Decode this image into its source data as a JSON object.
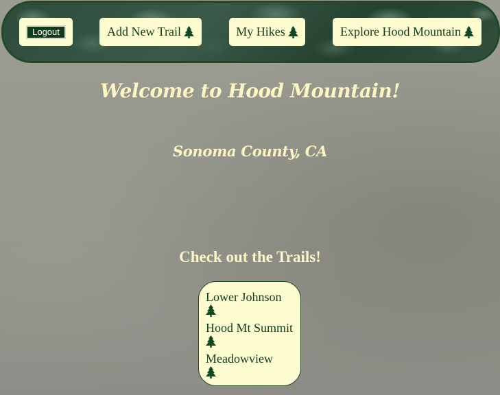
{
  "navbar": {
    "logout_label": "Logout",
    "links": [
      {
        "label": "Add New Trail",
        "icon": "tree-icon"
      },
      {
        "label": "My Hikes",
        "icon": "tree-icon"
      },
      {
        "label": "Explore Hood Mountain",
        "icon": "tree-icon"
      }
    ]
  },
  "hero": {
    "welcome": "Welcome to Hood Mountain!",
    "location": "Sonoma County, CA"
  },
  "trails": {
    "heading": "Check out the Trails!",
    "items": [
      {
        "name": "Lower Johnson",
        "icon": "tree-icon"
      },
      {
        "name": "Hood Mt Summit",
        "icon": "tree-icon"
      },
      {
        "name": "Meadowview",
        "icon": "tree-icon"
      }
    ]
  },
  "colors": {
    "accent_cream": "#fdfbd0",
    "dark_green": "#0f3d1a",
    "border_green": "#1f4a26",
    "heading_cream": "#fdf6c3",
    "background_gray": "#96978d"
  }
}
